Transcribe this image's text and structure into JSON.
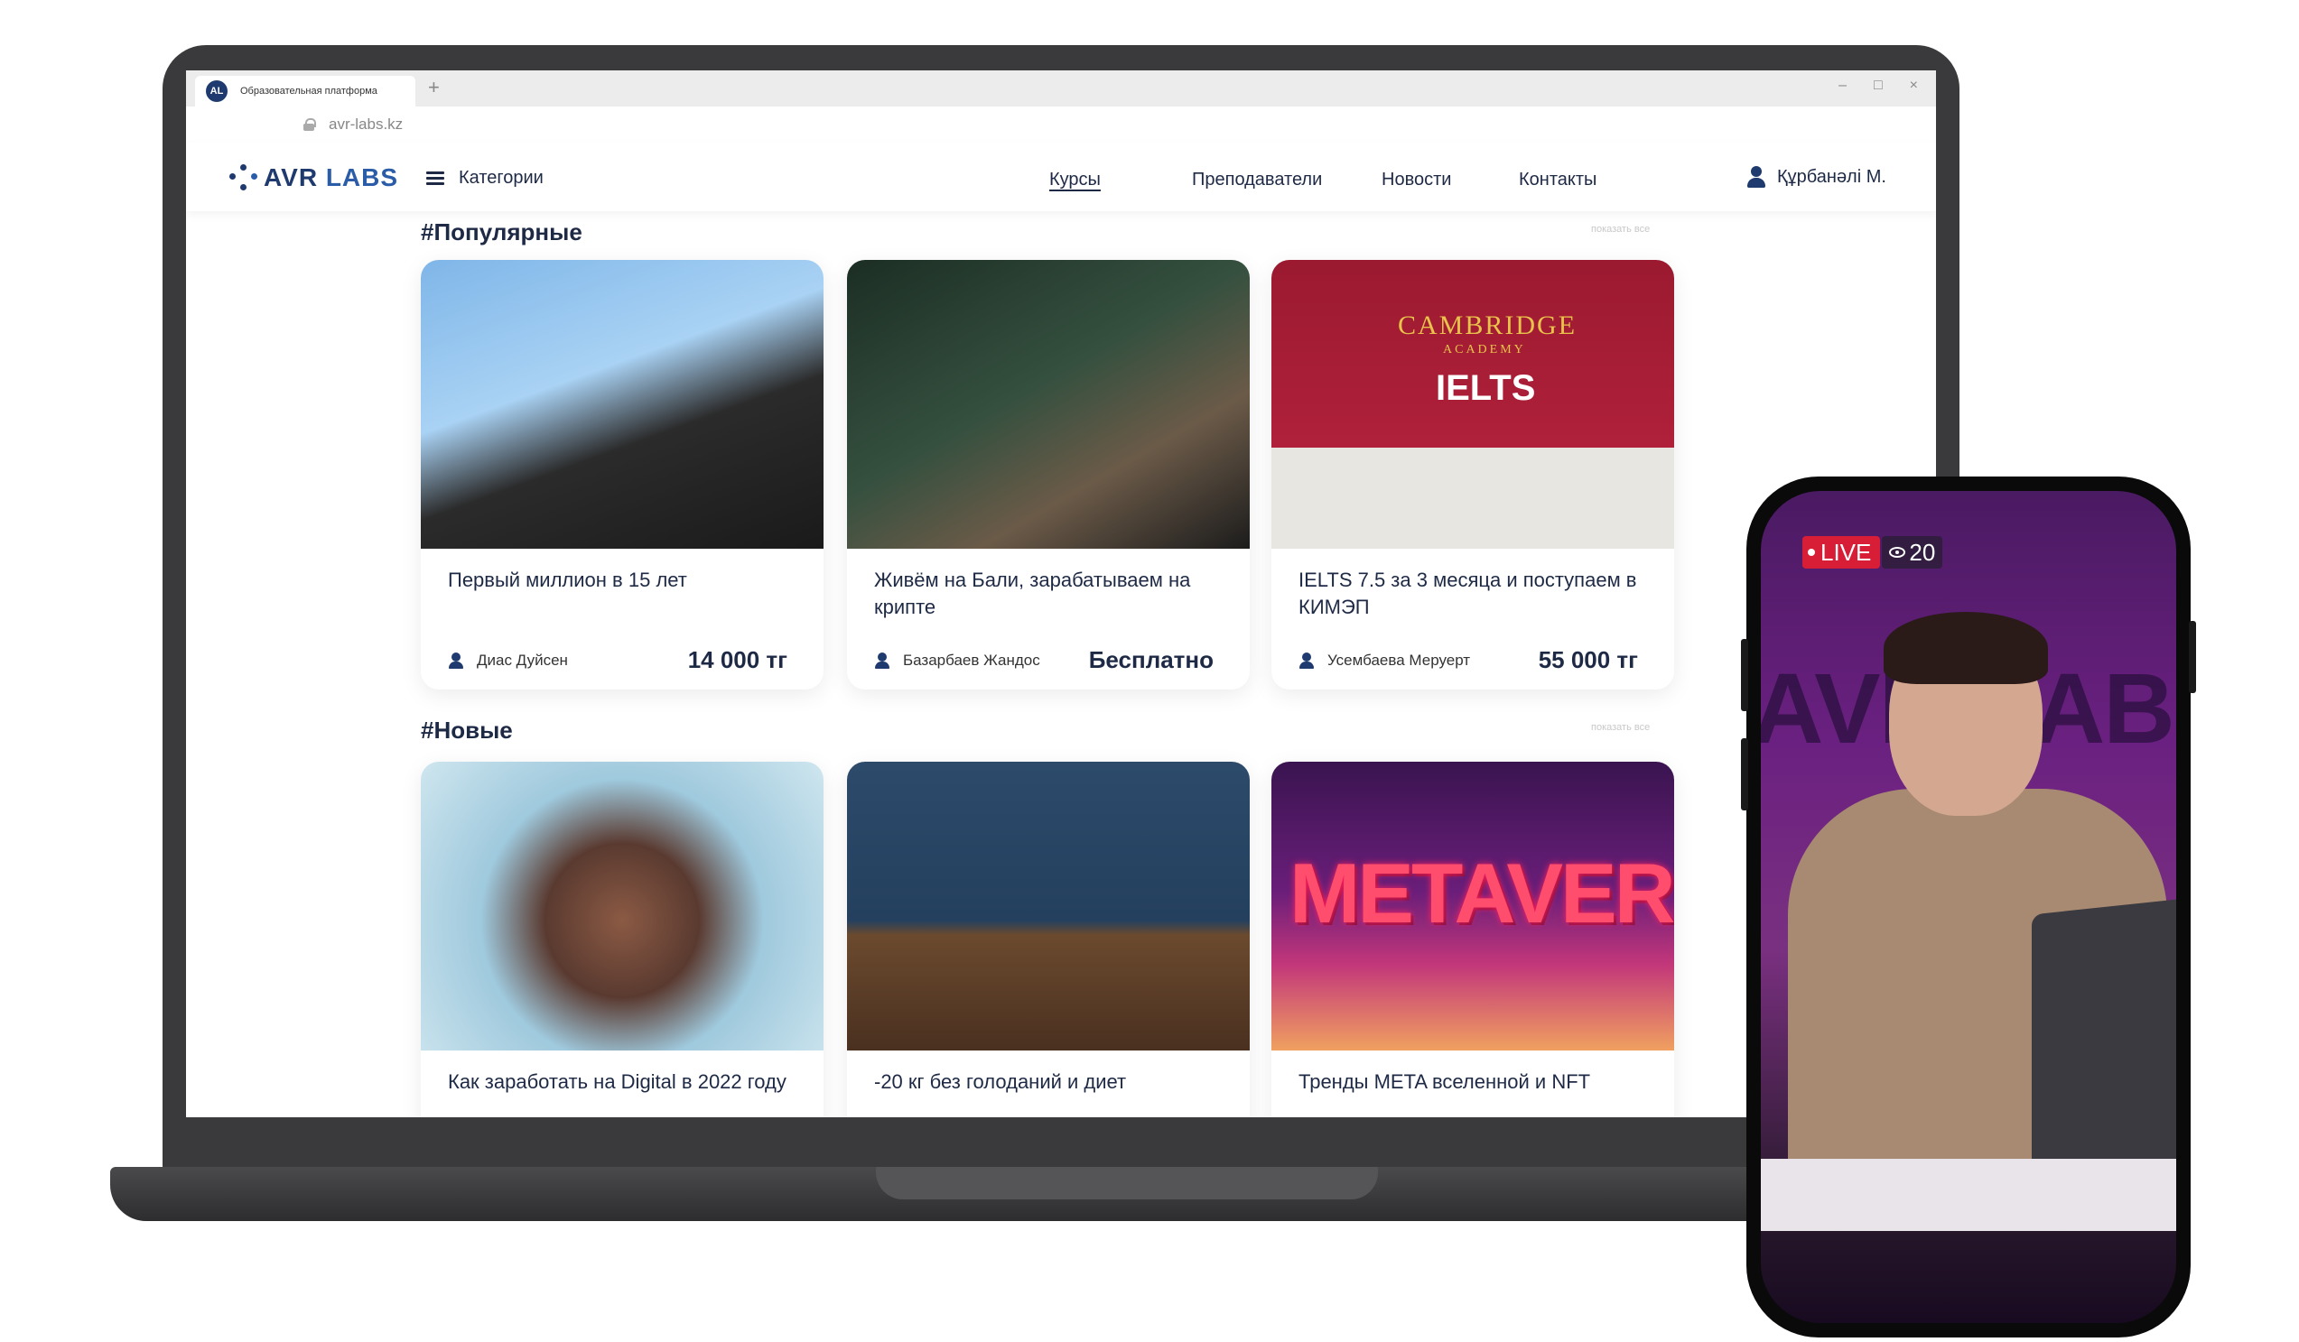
{
  "browser": {
    "tab_title": "Образовательная платформа",
    "favicon_text": "AL",
    "new_tab": "+",
    "url": "avr-labs.kz",
    "window_controls": [
      "–",
      "□",
      "×"
    ]
  },
  "header": {
    "logo_avr": "AVR",
    "logo_labs": " LABS",
    "categories_label": "Категории",
    "nav": [
      "Курсы",
      "Преподаватели",
      "Новости",
      "Контакты"
    ],
    "active_nav": "Курсы",
    "user_name": "Құрбанәлі М."
  },
  "sections": [
    {
      "title": "#Популярные",
      "show_all": "показать все",
      "cards": [
        {
          "title": "Первый миллион в 15 лет",
          "author": "Диас Дуйсен",
          "price": "14 000 тг"
        },
        {
          "title": "Живём на Бали, зарабатываем на крипте",
          "author": "Базарбаев Жандос",
          "price": "Бесплатно"
        },
        {
          "title": "IELTS 7.5 за 3 месяца и поступаем в КИМЭП",
          "author": "Усембаева Меруерт",
          "price": "55 000 тг"
        }
      ]
    },
    {
      "title": "#Новые",
      "show_all": "показать все",
      "cards": [
        {
          "title": "Как заработать на Digital в 2022 году"
        },
        {
          "title": "-20 кг без голоданий и диет"
        },
        {
          "title": "Тренды META вселенной и NFT"
        }
      ]
    }
  ],
  "image_text": {
    "cambridge": "CAMBRIDGE",
    "academy": "ACADEMY",
    "ielts": "IELTS",
    "metaverse": "METAVERSE"
  },
  "phone": {
    "live_label": "LIVE",
    "viewers": "20",
    "wall_text": "AVR LAB"
  },
  "colors": {
    "brand_navy": "#1e3a6e",
    "text_dark": "#1e2a45",
    "live_red": "#d81e36"
  }
}
